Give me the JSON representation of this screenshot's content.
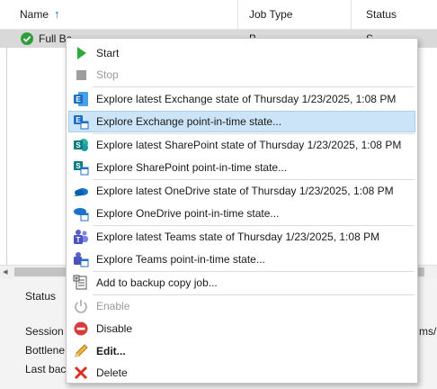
{
  "grid": {
    "columns": [
      "Name",
      "Job Type",
      "Status"
    ],
    "sort_arrow": "↑",
    "row": {
      "name": "Full Ba",
      "type": "B",
      "status": "S"
    }
  },
  "details": {
    "tab": "Status",
    "labels": [
      "Session s",
      "Bottlene",
      "Last bac"
    ],
    "right_text": "ms/"
  },
  "menu": {
    "items": [
      {
        "label": "Start",
        "icon": "play-icon",
        "enabled": true
      },
      {
        "label": "Stop",
        "icon": "stop-icon",
        "enabled": false
      },
      {
        "label": "Explore latest Exchange state of Thursday 1/23/2025, 1:08 PM",
        "icon": "exchange-icon",
        "enabled": true
      },
      {
        "label": "Explore Exchange point-in-time state...",
        "icon": "exchange-icon",
        "enabled": true,
        "highlighted": true
      },
      {
        "label": "Explore latest SharePoint state of Thursday 1/23/2025, 1:08 PM",
        "icon": "sharepoint-icon",
        "enabled": true
      },
      {
        "label": "Explore SharePoint point-in-time state...",
        "icon": "sharepoint-icon",
        "enabled": true
      },
      {
        "label": "Explore latest OneDrive state of Thursday 1/23/2025, 1:08 PM",
        "icon": "onedrive-icon",
        "enabled": true
      },
      {
        "label": "Explore OneDrive point-in-time state...",
        "icon": "onedrive-icon",
        "enabled": true
      },
      {
        "label": "Explore latest Teams state of Thursday 1/23/2025, 1:08 PM",
        "icon": "teams-icon",
        "enabled": true
      },
      {
        "label": "Explore Teams point-in-time state...",
        "icon": "teams-icon",
        "enabled": true
      },
      {
        "label": "Add to backup copy job...",
        "icon": "backup-copy-icon",
        "enabled": true
      },
      {
        "label": "Enable",
        "icon": "power-icon",
        "enabled": false
      },
      {
        "label": "Disable",
        "icon": "disable-icon",
        "enabled": true
      },
      {
        "label": "Edit...",
        "icon": "pencil-icon",
        "enabled": true,
        "bold": true
      },
      {
        "label": "Delete",
        "icon": "delete-x-icon",
        "enabled": true
      }
    ]
  },
  "colors": {
    "highlight": "#cce4f7",
    "exchange": "#1f6fc5",
    "sharepoint": "#0a7c82",
    "onedrive": "#1a73c8",
    "teams": "#5b5fc7",
    "start": "#2eaa3a",
    "disable": "#d93a3a",
    "delete": "#d93025"
  }
}
